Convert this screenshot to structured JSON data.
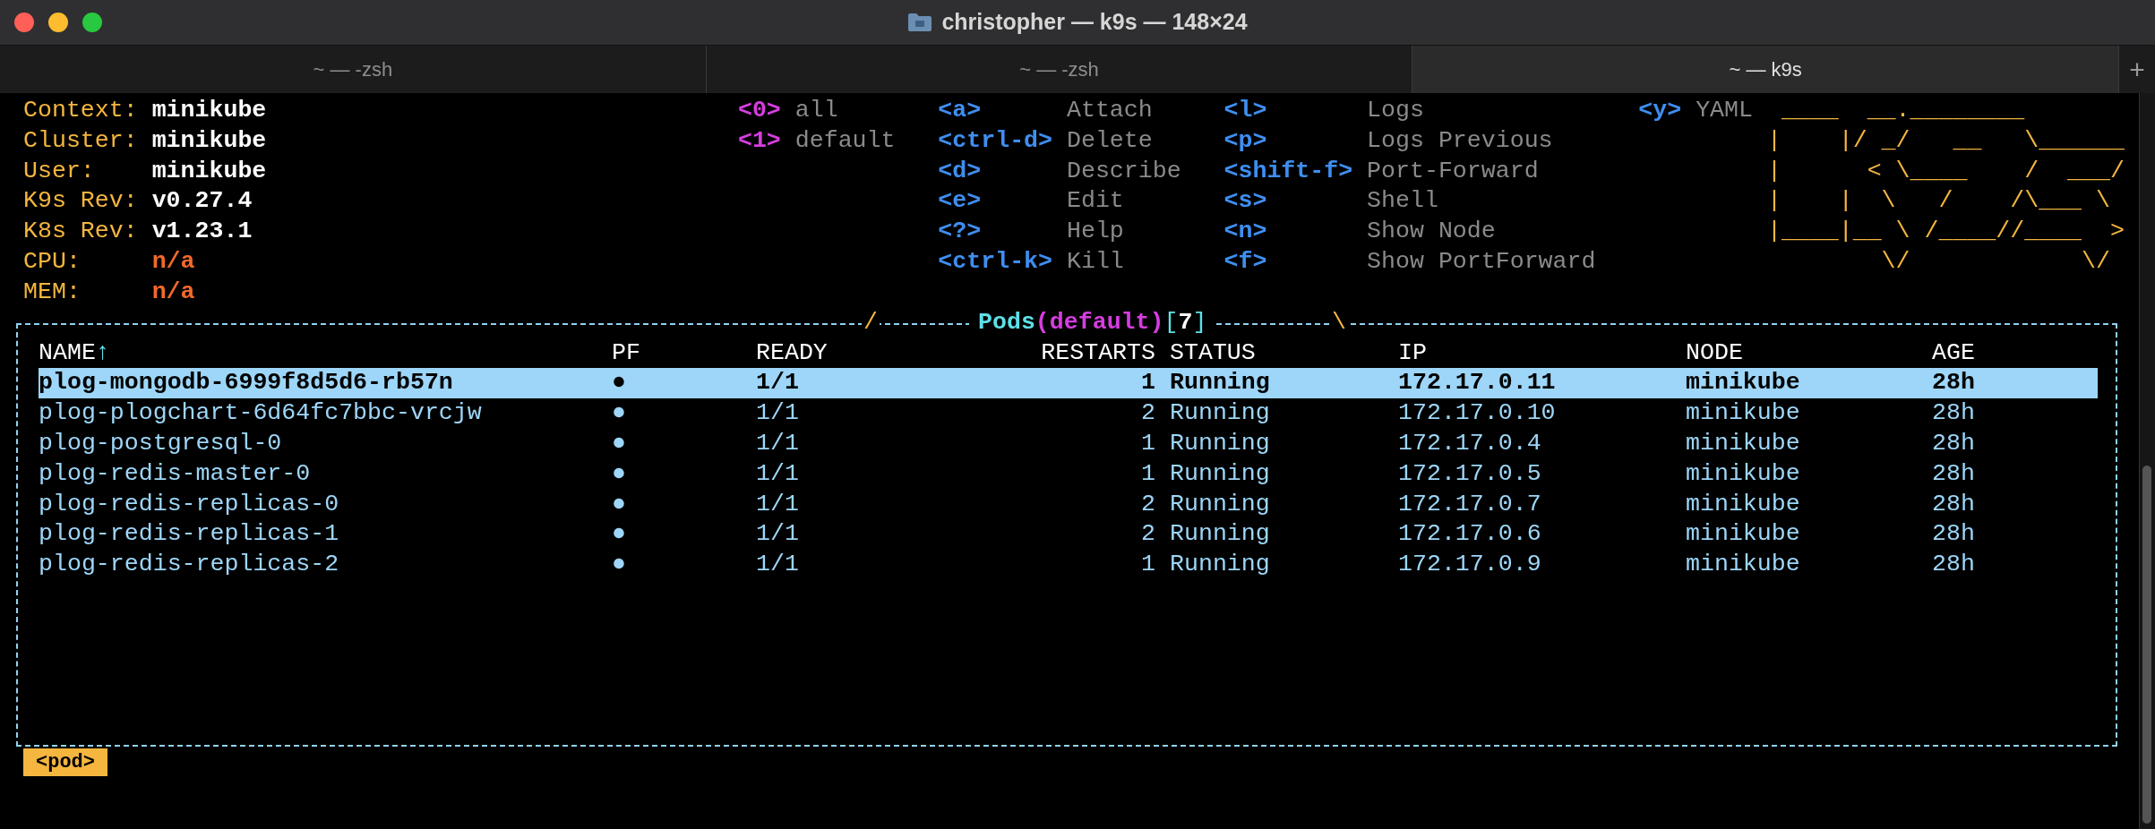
{
  "window": {
    "title": "christopher — k9s — 148×24"
  },
  "tabs": [
    {
      "label": "~ — -zsh",
      "selected": false
    },
    {
      "label": "~ — -zsh",
      "selected": false
    },
    {
      "label": "~ — k9s",
      "selected": true
    }
  ],
  "new_tab_button": "+",
  "cluster_info": [
    {
      "label": "Context:",
      "value": "minikube",
      "kind": "info"
    },
    {
      "label": "Cluster:",
      "value": "minikube",
      "kind": "info"
    },
    {
      "label": "User:",
      "value": "minikube",
      "kind": "info"
    },
    {
      "label": "K9s Rev:",
      "value": "v0.27.4",
      "kind": "info"
    },
    {
      "label": "K8s Rev:",
      "value": "v1.23.1",
      "kind": "info"
    },
    {
      "label": "CPU:",
      "value": "n/a",
      "kind": "metric"
    },
    {
      "label": "MEM:",
      "value": "n/a",
      "kind": "metric"
    }
  ],
  "namespaces": [
    {
      "key": "<0>",
      "name": "all"
    },
    {
      "key": "<1>",
      "name": "default"
    }
  ],
  "shortcuts": [
    [
      {
        "key": "<a>",
        "action": "Attach"
      },
      {
        "key": "<ctrl-d>",
        "action": "Delete"
      },
      {
        "key": "<d>",
        "action": "Describe"
      },
      {
        "key": "<e>",
        "action": "Edit"
      },
      {
        "key": "<?>",
        "action": "Help"
      },
      {
        "key": "<ctrl-k>",
        "action": "Kill"
      }
    ],
    [
      {
        "key": "<l>",
        "action": "Logs"
      },
      {
        "key": "<p>",
        "action": "Logs Previous"
      },
      {
        "key": "<shift-f>",
        "action": "Port-Forward"
      },
      {
        "key": "<s>",
        "action": "Shell"
      },
      {
        "key": "<n>",
        "action": "Show Node"
      },
      {
        "key": "<f>",
        "action": "Show PortForward"
      }
    ],
    [
      {
        "key": "<y>",
        "action": "YAML"
      }
    ]
  ],
  "logo": [
    " ____  __.________       ",
    "|    |/ _/   __   \\______ ",
    "|      < \\____    /  ___/ ",
    "|    |  \\   /    /\\___ \\  ",
    "|____|__ \\ /____//____  > ",
    "        \\/            \\/  "
  ],
  "table": {
    "title": {
      "open": "/",
      "parts": [
        {
          "text": "Pods",
          "kind": "resource"
        },
        {
          "text": "(default)",
          "kind": "namespace"
        },
        {
          "text": "[",
          "kind": "bracket"
        },
        {
          "text": "7",
          "kind": "count"
        },
        {
          "text": "]",
          "kind": "bracket"
        }
      ],
      "close": "\\"
    },
    "columns": [
      {
        "label": "NAME",
        "sort_mark": "↑"
      },
      {
        "label": "PF"
      },
      {
        "label": "READY"
      },
      {
        "label": "RESTARTS"
      },
      {
        "label": "STATUS"
      },
      {
        "label": "IP"
      },
      {
        "label": "NODE"
      },
      {
        "label": "AGE"
      }
    ],
    "rows": [
      {
        "selected": true,
        "cells": [
          "plog-mongodb-6999f8d5d6-rb57n",
          "●",
          "1/1",
          "1",
          "Running",
          "172.17.0.11",
          "minikube",
          "28h"
        ]
      },
      {
        "selected": false,
        "cells": [
          "plog-plogchart-6d64fc7bbc-vrcjw",
          "●",
          "1/1",
          "2",
          "Running",
          "172.17.0.10",
          "minikube",
          "28h"
        ]
      },
      {
        "selected": false,
        "cells": [
          "plog-postgresql-0",
          "●",
          "1/1",
          "1",
          "Running",
          "172.17.0.4",
          "minikube",
          "28h"
        ]
      },
      {
        "selected": false,
        "cells": [
          "plog-redis-master-0",
          "●",
          "1/1",
          "1",
          "Running",
          "172.17.0.5",
          "minikube",
          "28h"
        ]
      },
      {
        "selected": false,
        "cells": [
          "plog-redis-replicas-0",
          "●",
          "1/1",
          "2",
          "Running",
          "172.17.0.7",
          "minikube",
          "28h"
        ]
      },
      {
        "selected": false,
        "cells": [
          "plog-redis-replicas-1",
          "●",
          "1/1",
          "2",
          "Running",
          "172.17.0.6",
          "minikube",
          "28h"
        ]
      },
      {
        "selected": false,
        "cells": [
          "plog-redis-replicas-2",
          "●",
          "1/1",
          "1",
          "Running",
          "172.17.0.9",
          "minikube",
          "28h"
        ]
      }
    ]
  },
  "crumbs": [
    {
      "label": "<pod>"
    }
  ]
}
